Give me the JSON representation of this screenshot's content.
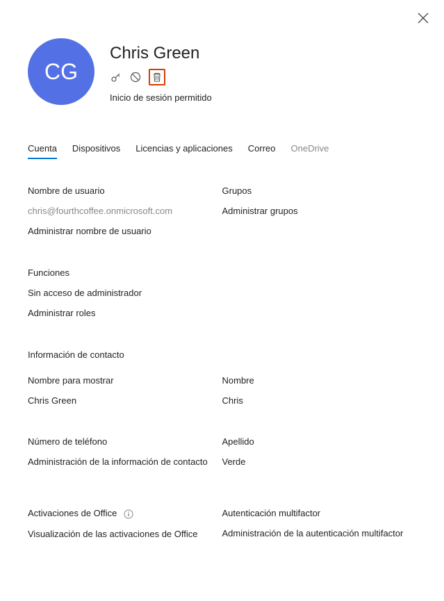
{
  "user": {
    "initials": "CG",
    "name": "Chris Green",
    "status": "Inicio de sesión permitido"
  },
  "tabs": {
    "account": "Cuenta",
    "devices": "Dispositivos",
    "licenses": "Licencias y aplicaciones",
    "mail": "Correo",
    "onedrive": "OneDrive"
  },
  "account": {
    "username_label": "Nombre de usuario",
    "username_value": "chris@fourthcoffee.onmicrosoft.com",
    "manage_username": "Administrar nombre de usuario",
    "groups_label": "Grupos",
    "manage_groups": "Administrar grupos",
    "roles_label": "Funciones",
    "roles_value": "Sin acceso de administrador",
    "manage_roles": "Administrar roles",
    "contact_info_label": "Información de contacto",
    "display_name_label": "Nombre para mostrar",
    "display_name_value": "Chris Green",
    "first_name_label": "Nombre",
    "first_name_value": "Chris",
    "phone_label": "Número de teléfono",
    "manage_contact": "Administración de la información de contacto",
    "last_name_label": "Apellido",
    "last_name_value": "Verde",
    "office_activations_label": "Activaciones de Office",
    "view_activations": "Visualización de las activaciones de Office",
    "mfa_label": "Autenticación multifactor",
    "manage_mfa": "Administración de la autenticación multifactor"
  }
}
